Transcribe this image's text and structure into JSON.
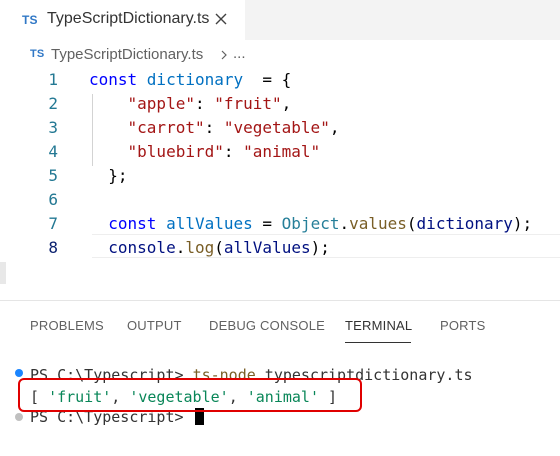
{
  "tab": {
    "badge": "TS",
    "title": "TypeScriptDictionary.ts",
    "close_icon": "close-icon"
  },
  "breadcrumb": {
    "badge": "TS",
    "file": "TypeScriptDictionary.ts",
    "more": "..."
  },
  "editor": {
    "lines": [
      {
        "n": "1",
        "parts": [
          [
            "kw",
            "const "
          ],
          [
            "var",
            "dictionary"
          ],
          [
            "",
            "  = {"
          ]
        ]
      },
      {
        "n": "2",
        "parts": [
          [
            "str",
            "\"apple\""
          ],
          [
            "",
            ": "
          ],
          [
            "str",
            "\"fruit\""
          ],
          [
            "",
            ","
          ]
        ]
      },
      {
        "n": "3",
        "parts": [
          [
            "str",
            "\"carrot\""
          ],
          [
            "",
            ": "
          ],
          [
            "str",
            "\"vegetable\""
          ],
          [
            "",
            ","
          ]
        ]
      },
      {
        "n": "4",
        "parts": [
          [
            "str",
            "\"bluebird\""
          ],
          [
            "",
            ": "
          ],
          [
            "str",
            "\"animal\""
          ]
        ]
      },
      {
        "n": "5",
        "parts": [
          [
            "",
            "};"
          ]
        ]
      },
      {
        "n": "6",
        "parts": []
      },
      {
        "n": "7",
        "parts": [
          [
            "kw",
            "const "
          ],
          [
            "var",
            "allValues"
          ],
          [
            "",
            " = "
          ],
          [
            "obj",
            "Object"
          ],
          [
            "",
            "."
          ],
          [
            "fn",
            "values"
          ],
          [
            "",
            "("
          ],
          [
            "param",
            "dictionary"
          ],
          [
            "",
            ");"
          ]
        ]
      },
      {
        "n": "8",
        "parts": [
          [
            "param",
            "console"
          ],
          [
            "",
            "."
          ],
          [
            "fn",
            "log"
          ],
          [
            "",
            "("
          ],
          [
            "param",
            "allValues"
          ],
          [
            "",
            ");"
          ]
        ]
      }
    ],
    "active_line": "8"
  },
  "panel": {
    "tabs": [
      "PROBLEMS",
      "OUTPUT",
      "DEBUG CONSOLE",
      "TERMINAL",
      "PORTS"
    ],
    "active_tab": "TERMINAL"
  },
  "terminal": {
    "prompt1": "PS C:\\Typescript> ",
    "command": "ts-node",
    "command_arg": " typescriptdictionary.ts",
    "output_open": "[ ",
    "output_values": [
      "'fruit'",
      "'vegetable'",
      "'animal'"
    ],
    "output_close": " ]",
    "prompt2": "PS C:\\Typescript> ",
    "highlight_color": "#e00000"
  }
}
